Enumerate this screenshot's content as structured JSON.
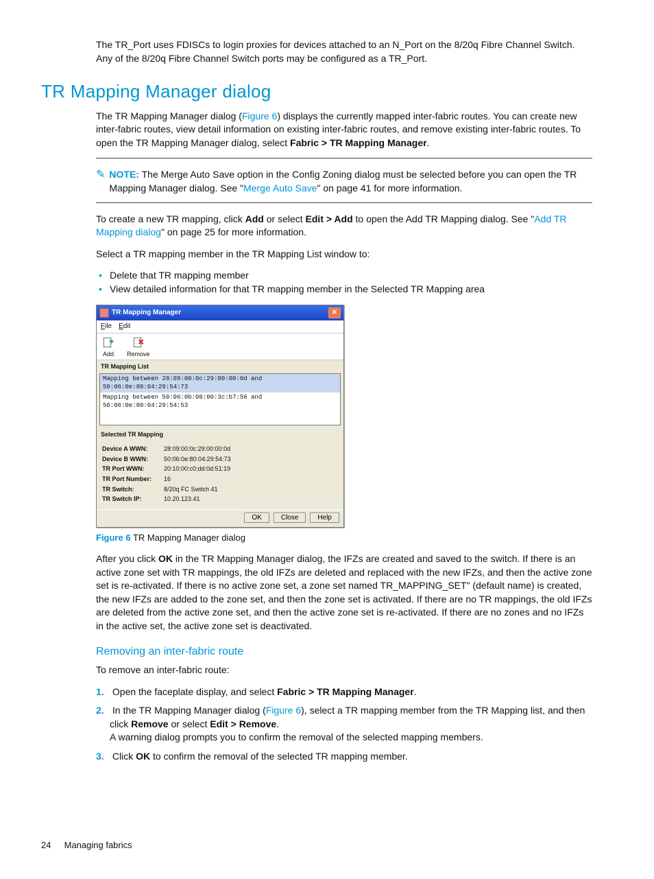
{
  "intro_pre": "The TR_Port uses FDISCs to login proxies for devices attached to an N_Port on the 8/20q Fibre Channel Switch. Any of the 8/20q Fibre Channel Switch ports may be configured as a TR_Port.",
  "h1": "TR Mapping Manager dialog",
  "p1_a": "The TR Mapping Manager dialog (",
  "p1_link": "Figure 6",
  "p1_b": ") displays the currently mapped inter-fabric routes. You can create new inter-fabric routes, view detail information on existing inter-fabric routes, and remove existing inter-fabric routes. To open the TR Mapping Manager dialog, select ",
  "p1_bold": "Fabric > TR Mapping Manager",
  "p1_c": ".",
  "note_label": "NOTE:",
  "note_a": "The Merge Auto Save option in the Config Zoning dialog must be selected before you can open the TR Mapping Manager dialog. See \"",
  "note_link": "Merge Auto Save",
  "note_b": "\" on page 41 for more information.",
  "p2_a": "To create a new TR mapping, click ",
  "p2_b1": "Add",
  "p2_b": " or select ",
  "p2_b2": "Edit > Add",
  "p2_c": " to open the Add TR Mapping dialog. See \"",
  "p2_link": "Add TR Mapping dialog",
  "p2_d": "\" on page 25 for more information.",
  "p3": "Select a TR mapping member in the TR Mapping List window to:",
  "bullets": [
    "Delete that TR mapping member",
    "View detailed information for that TR mapping member in the Selected TR Mapping area"
  ],
  "dialog": {
    "title": "TR Mapping Manager",
    "menu_file": "File",
    "menu_edit": "Edit",
    "tool_add": "Add",
    "tool_remove": "Remove",
    "list_label": "TR Mapping List",
    "rows": [
      "Mapping between 28:09:00:0c:29:00:00:0d and 50:06:0e:80:04:29:54:73",
      "Mapping between 50:06:0b:00:00:3c:b7:56 and 50:06:0e:80:04:29:54:53"
    ],
    "selected_label": "Selected TR Mapping",
    "details": {
      "Device A WWN:": "28:09:00:0c:29:00:00:0d",
      "Device B WWN:": "50:06:0e:80:04:29:54:73",
      "TR Port WWN:": "20:10:00:c0:dd:0d:51:19",
      "TR Port Number:": "16",
      "TR Switch:": "8/20q FC Switch 41",
      "TR Switch IP:": "10.20.123.41"
    },
    "btn_ok": "OK",
    "btn_close": "Close",
    "btn_help": "Help"
  },
  "fig_label": "Figure 6",
  "fig_caption": "TR Mapping Manager dialog",
  "p4_a": "After you click ",
  "p4_b1": "OK",
  "p4_b": " in the TR Mapping Manager dialog, the IFZs are created and saved to the switch. If there is an active zone set with TR mappings, the old IFZs are deleted and replaced with the new IFZs, and then the active zone set is re-activated. If there is no active zone set, a zone set named TR_MAPPING_SET\" (default name) is created, the new IFZs are added to the zone set, and then the zone set is activated. If there are no TR mappings, the old IFZs are deleted from the active zone set, and then the active zone set is re-activated. If there are no zones and no IFZs in the active set, the active zone set is deactivated.",
  "h3": "Removing an inter-fabric route",
  "p5": "To remove an inter-fabric route:",
  "step1_a": "Open the faceplate display, and select ",
  "step1_b": "Fabric > TR Mapping Manager",
  "step1_c": ".",
  "step2_a": "In the TR Mapping Manager dialog (",
  "step2_link": "Figure 6",
  "step2_b": "), select a TR mapping member from the TR Mapping list, and then click ",
  "step2_b1": "Remove",
  "step2_c": " or select ",
  "step2_b2": "Edit > Remove",
  "step2_d": ".",
  "step2_e": "A warning dialog prompts you to confirm the removal of the selected mapping members.",
  "step3_a": "Click ",
  "step3_b": "OK",
  "step3_c": " to confirm the removal of the selected TR mapping member.",
  "footer_page": "24",
  "footer_text": "Managing fabrics"
}
